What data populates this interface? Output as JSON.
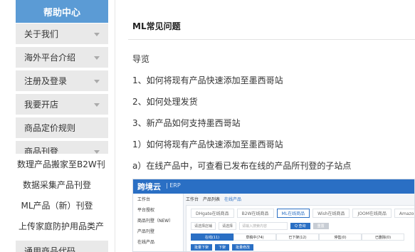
{
  "sidebar": {
    "header": "帮助中心",
    "items": [
      {
        "label": "关于我们"
      },
      {
        "label": "海外平台介绍"
      },
      {
        "label": "注册及登录"
      },
      {
        "label": "我要开店"
      },
      {
        "label": "商品定价规则"
      },
      {
        "label": "商品刊登"
      }
    ],
    "sub_items": [
      {
        "label": "数理产品搬家至B2W刊"
      },
      {
        "label": "数据采集产品刊登"
      },
      {
        "label": "ML产品（新）刊登"
      },
      {
        "label": "上传家庭防护用品类产"
      }
    ],
    "bottom_item": "通用商品代码"
  },
  "main": {
    "title": "ML常见问题",
    "paragraphs": [
      "导览",
      "1、如何将现有产品快速添加至墨西哥站",
      "2、如何处理发货",
      "3、新产品如何支持墨西哥站",
      "1）如何将现有产品快速添加至墨西哥站",
      "a）在线产品中，可查看已发布在线的产品所刊登的子站点"
    ]
  },
  "erp": {
    "logo": "跨境云",
    "logo_sub": "| ERP",
    "tabs": [
      "工作台",
      "产品列表",
      "在线产品"
    ],
    "side_items": [
      "工作台",
      "平台授权",
      "商品刊登（NEW）",
      "产品刊登",
      "在线产品"
    ],
    "sites": [
      "DHgate在线商品",
      "B2W在线商品",
      "ML在线商品",
      "Wish在线商品",
      "JOOM在线商品",
      "Amazon在线商品"
    ],
    "filters": [
      "请选择店铺",
      "请选择",
      "请输入搜索内容"
    ],
    "search_btn": "Q 查询",
    "reset_btn": "重置",
    "statuses": [
      "在线(11)",
      "草稿中(74)",
      "已下架(12)",
      "停售(0)",
      "已删除(0)"
    ],
    "actions": [
      "批量下架",
      "下架",
      "批量修改"
    ]
  }
}
